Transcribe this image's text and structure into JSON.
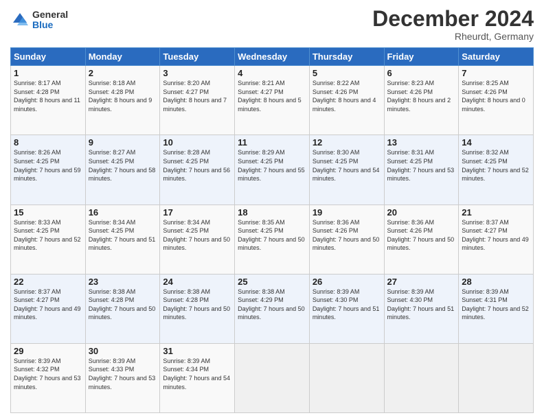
{
  "logo": {
    "general": "General",
    "blue": "Blue"
  },
  "header": {
    "month": "December 2024",
    "location": "Rheurdt, Germany"
  },
  "weekdays": [
    "Sunday",
    "Monday",
    "Tuesday",
    "Wednesday",
    "Thursday",
    "Friday",
    "Saturday"
  ],
  "weeks": [
    [
      {
        "day": "1",
        "sunrise": "8:17 AM",
        "sunset": "4:28 PM",
        "daylight": "8 hours and 11 minutes."
      },
      {
        "day": "2",
        "sunrise": "8:18 AM",
        "sunset": "4:28 PM",
        "daylight": "8 hours and 9 minutes."
      },
      {
        "day": "3",
        "sunrise": "8:20 AM",
        "sunset": "4:27 PM",
        "daylight": "8 hours and 7 minutes."
      },
      {
        "day": "4",
        "sunrise": "8:21 AM",
        "sunset": "4:27 PM",
        "daylight": "8 hours and 5 minutes."
      },
      {
        "day": "5",
        "sunrise": "8:22 AM",
        "sunset": "4:26 PM",
        "daylight": "8 hours and 4 minutes."
      },
      {
        "day": "6",
        "sunrise": "8:23 AM",
        "sunset": "4:26 PM",
        "daylight": "8 hours and 2 minutes."
      },
      {
        "day": "7",
        "sunrise": "8:25 AM",
        "sunset": "4:26 PM",
        "daylight": "8 hours and 0 minutes."
      }
    ],
    [
      {
        "day": "8",
        "sunrise": "8:26 AM",
        "sunset": "4:25 PM",
        "daylight": "7 hours and 59 minutes."
      },
      {
        "day": "9",
        "sunrise": "8:27 AM",
        "sunset": "4:25 PM",
        "daylight": "7 hours and 58 minutes."
      },
      {
        "day": "10",
        "sunrise": "8:28 AM",
        "sunset": "4:25 PM",
        "daylight": "7 hours and 56 minutes."
      },
      {
        "day": "11",
        "sunrise": "8:29 AM",
        "sunset": "4:25 PM",
        "daylight": "7 hours and 55 minutes."
      },
      {
        "day": "12",
        "sunrise": "8:30 AM",
        "sunset": "4:25 PM",
        "daylight": "7 hours and 54 minutes."
      },
      {
        "day": "13",
        "sunrise": "8:31 AM",
        "sunset": "4:25 PM",
        "daylight": "7 hours and 53 minutes."
      },
      {
        "day": "14",
        "sunrise": "8:32 AM",
        "sunset": "4:25 PM",
        "daylight": "7 hours and 52 minutes."
      }
    ],
    [
      {
        "day": "15",
        "sunrise": "8:33 AM",
        "sunset": "4:25 PM",
        "daylight": "7 hours and 52 minutes."
      },
      {
        "day": "16",
        "sunrise": "8:34 AM",
        "sunset": "4:25 PM",
        "daylight": "7 hours and 51 minutes."
      },
      {
        "day": "17",
        "sunrise": "8:34 AM",
        "sunset": "4:25 PM",
        "daylight": "7 hours and 50 minutes."
      },
      {
        "day": "18",
        "sunrise": "8:35 AM",
        "sunset": "4:25 PM",
        "daylight": "7 hours and 50 minutes."
      },
      {
        "day": "19",
        "sunrise": "8:36 AM",
        "sunset": "4:26 PM",
        "daylight": "7 hours and 50 minutes."
      },
      {
        "day": "20",
        "sunrise": "8:36 AM",
        "sunset": "4:26 PM",
        "daylight": "7 hours and 50 minutes."
      },
      {
        "day": "21",
        "sunrise": "8:37 AM",
        "sunset": "4:27 PM",
        "daylight": "7 hours and 49 minutes."
      }
    ],
    [
      {
        "day": "22",
        "sunrise": "8:37 AM",
        "sunset": "4:27 PM",
        "daylight": "7 hours and 49 minutes."
      },
      {
        "day": "23",
        "sunrise": "8:38 AM",
        "sunset": "4:28 PM",
        "daylight": "7 hours and 50 minutes."
      },
      {
        "day": "24",
        "sunrise": "8:38 AM",
        "sunset": "4:28 PM",
        "daylight": "7 hours and 50 minutes."
      },
      {
        "day": "25",
        "sunrise": "8:38 AM",
        "sunset": "4:29 PM",
        "daylight": "7 hours and 50 minutes."
      },
      {
        "day": "26",
        "sunrise": "8:39 AM",
        "sunset": "4:30 PM",
        "daylight": "7 hours and 51 minutes."
      },
      {
        "day": "27",
        "sunrise": "8:39 AM",
        "sunset": "4:30 PM",
        "daylight": "7 hours and 51 minutes."
      },
      {
        "day": "28",
        "sunrise": "8:39 AM",
        "sunset": "4:31 PM",
        "daylight": "7 hours and 52 minutes."
      }
    ],
    [
      {
        "day": "29",
        "sunrise": "8:39 AM",
        "sunset": "4:32 PM",
        "daylight": "7 hours and 53 minutes."
      },
      {
        "day": "30",
        "sunrise": "8:39 AM",
        "sunset": "4:33 PM",
        "daylight": "7 hours and 53 minutes."
      },
      {
        "day": "31",
        "sunrise": "8:39 AM",
        "sunset": "4:34 PM",
        "daylight": "7 hours and 54 minutes."
      },
      null,
      null,
      null,
      null
    ]
  ],
  "labels": {
    "sunrise": "Sunrise:",
    "sunset": "Sunset:",
    "daylight": "Daylight:"
  }
}
